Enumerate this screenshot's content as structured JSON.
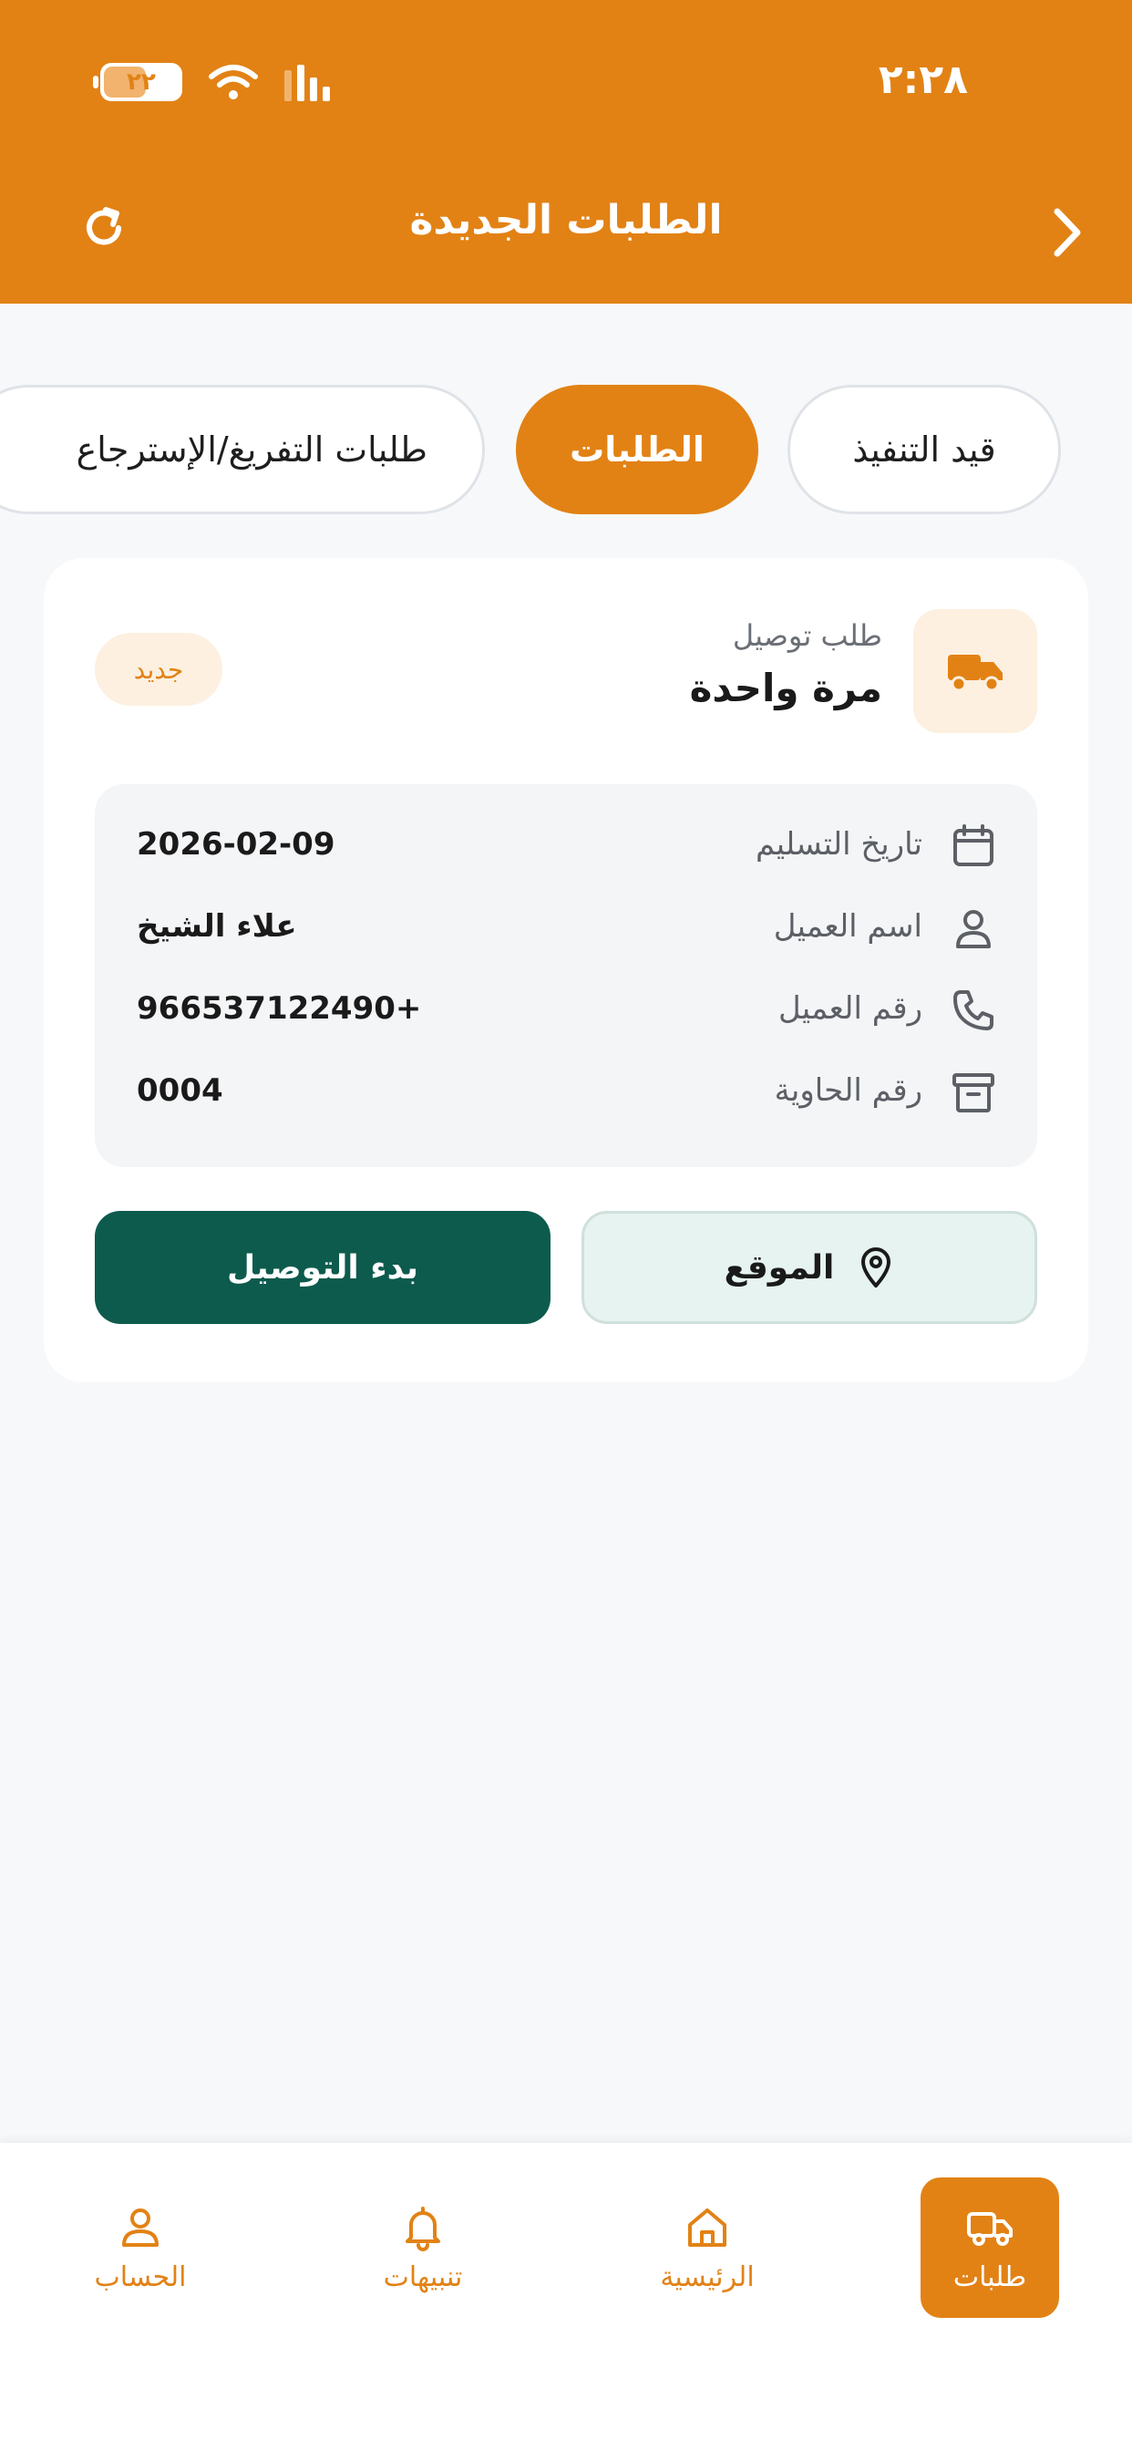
{
  "status_bar": {
    "time": "٢:٢٨",
    "battery": "٢٢",
    "wifi_icon": "wifi-icon",
    "signal_icon": "signal-icon"
  },
  "header": {
    "title": "الطلبات الجديدة",
    "back_icon": "chevron-right-icon",
    "refresh_icon": "refresh-icon"
  },
  "tabs": [
    {
      "label": "قيد التنفيذ",
      "active": false
    },
    {
      "label": "الطلبات",
      "active": true
    },
    {
      "label": "طلبات التفريغ/الإسترجاع",
      "active": false
    }
  ],
  "order_card": {
    "icon": "truck-icon",
    "type_label": "طلب توصيل",
    "type_value": "مرة واحدة",
    "badge": "جديد",
    "details": [
      {
        "icon": "calendar-icon",
        "label": "تاريخ التسليم",
        "value": "2026-02-09"
      },
      {
        "icon": "user-icon",
        "label": "اسم العميل",
        "value": "علاء الشيخ"
      },
      {
        "icon": "phone-icon",
        "label": "رقم العميل",
        "value": "966537122490+"
      },
      {
        "icon": "archive-icon",
        "label": "رقم الحاوية",
        "value": "0004"
      }
    ],
    "location_button": "الموقع",
    "start_button": "بدء التوصيل"
  },
  "bottom_nav": [
    {
      "label": "طلبات",
      "icon": "truck-icon",
      "active": true
    },
    {
      "label": "الرئيسية",
      "icon": "home-icon",
      "active": false
    },
    {
      "label": "تنبيهات",
      "icon": "bell-icon",
      "active": false
    },
    {
      "label": "الحساب",
      "icon": "user-icon",
      "active": false
    }
  ],
  "colors": {
    "primary": "#e28215",
    "dark_green": "#0d5b4d",
    "light_green": "#e6f3f0",
    "badge_bg": "#fdf0e0",
    "background": "#f7f8fa"
  }
}
